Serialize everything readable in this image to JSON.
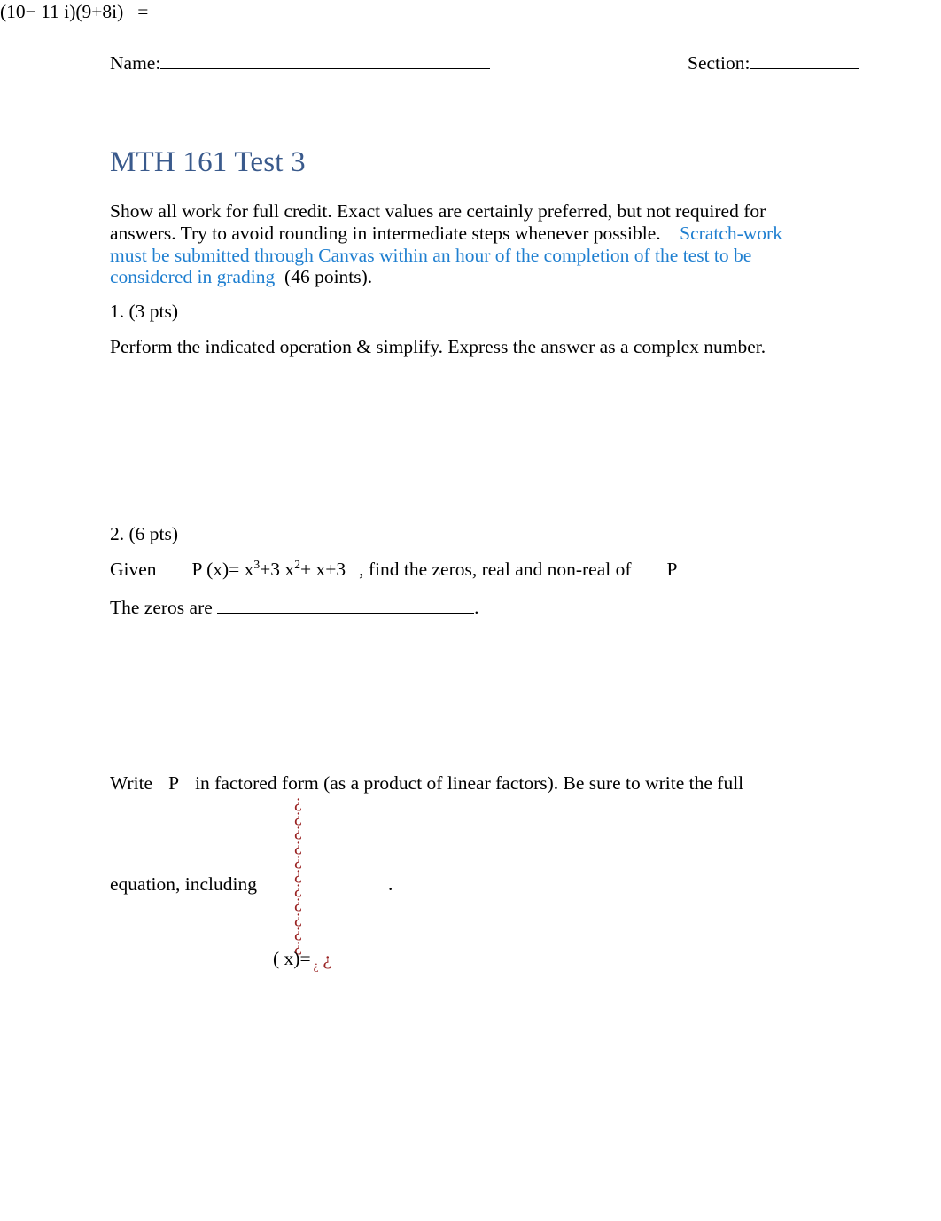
{
  "header": {
    "name_label": "Name:",
    "section_label": "Section:"
  },
  "title": "MTH 161 Test 3",
  "instructions": {
    "black_part_1": "Show all work for full credit. Exact values are certainly preferred, but not required for answers.   Try to avoid rounding in intermediate steps whenever possible.",
    "blue_part": "Scratch-work must be submitted through Canvas within an hour of the completion of the test to be considered in grading",
    "black_part_2": "(46 points)."
  },
  "questions": [
    {
      "number_label": "1. (3 pts)",
      "prompt": "Perform the indicated operation & simplify. Express the answer as a complex number.",
      "expression": "(10− 11 i)(9+8i)",
      "equals": "="
    },
    {
      "number_label": "2. (6 pts)",
      "given_word": "Given",
      "poly_lead": "P (x)= x",
      "poly_exp1": "3",
      "poly_mid": "+3 x",
      "poly_exp2": "2",
      "poly_tail": "+ x+3",
      "given_rest": ", find the zeros, real and non-real of",
      "function_symbol": "P",
      "zeros_label": "The zeros are",
      "zeros_period": ".",
      "write_lead": "Write",
      "write_symbol": "P",
      "write_rest": "in factored form (as a product of linear factors). Be sure to write the full",
      "equation_label": "equation, including",
      "equation_period": ".",
      "broken_placeholder_char": "¿",
      "broken_placeholder_count": 11,
      "broken_tail": "( x)=",
      "broken_tail_sub": "¿",
      "broken_tail_red": "¿"
    }
  ],
  "colors": {
    "title_blue": "#3a5a8c",
    "link_blue": "#1f7fd0",
    "error_red": "#992222",
    "text_black": "#000000",
    "page_background": "#ffffff"
  }
}
